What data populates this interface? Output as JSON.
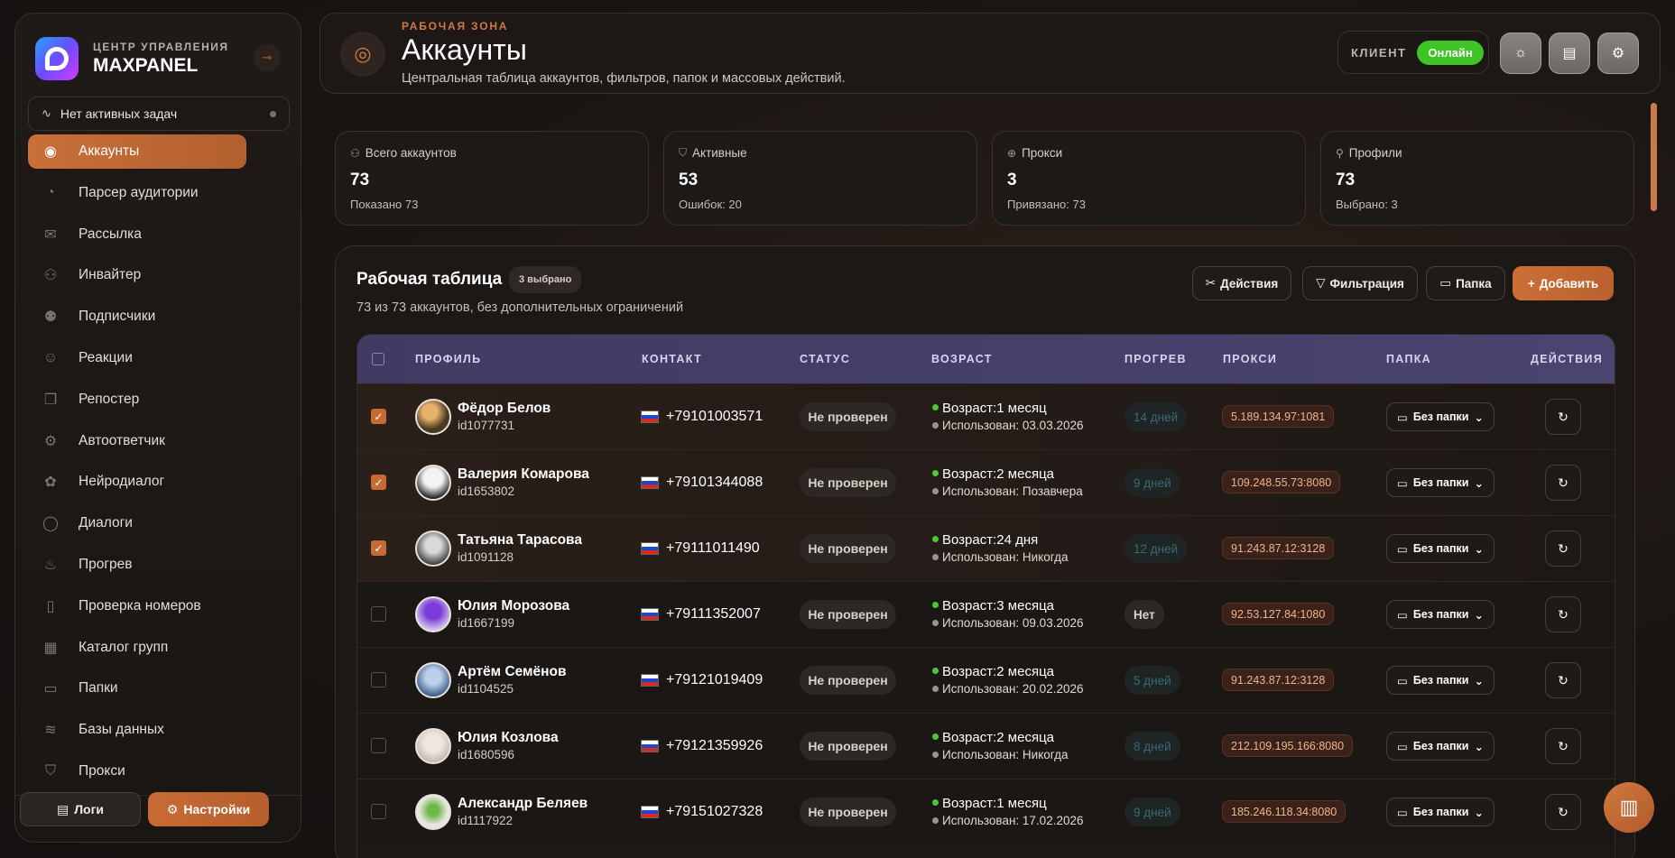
{
  "brand": {
    "subtitle": "ЦЕНТР УПРАВЛЕНИЯ",
    "title": "MAXPANEL",
    "pin_icon": "pin-icon"
  },
  "tasks": {
    "label": "Нет активных задач",
    "icon": "pulse-icon"
  },
  "sidebar": {
    "items": [
      {
        "label": "Аккаунты",
        "icon": "user-circle-icon",
        "glyph": "◉",
        "active": true
      },
      {
        "label": "Парсер аудитории",
        "icon": "radar-icon",
        "glyph": "◔",
        "active": false
      },
      {
        "label": "Рассылка",
        "icon": "mail-icon",
        "glyph": "✉",
        "active": false
      },
      {
        "label": "Инвайтер",
        "icon": "user-plus-icon",
        "glyph": "⚇",
        "active": false
      },
      {
        "label": "Подписчики",
        "icon": "users-icon",
        "glyph": "⚉",
        "active": false
      },
      {
        "label": "Реакции",
        "icon": "smile-icon",
        "glyph": "☺",
        "active": false
      },
      {
        "label": "Репостер",
        "icon": "copy-icon",
        "glyph": "❐",
        "active": false
      },
      {
        "label": "Автоответчик",
        "icon": "bot-icon",
        "glyph": "⚙",
        "active": false
      },
      {
        "label": "Нейродиалог",
        "icon": "brain-icon",
        "glyph": "✿",
        "active": false
      },
      {
        "label": "Диалоги",
        "icon": "chat-icon",
        "glyph": "◯",
        "active": false
      },
      {
        "label": "Прогрев",
        "icon": "flame-icon",
        "glyph": "♨",
        "active": false
      },
      {
        "label": "Проверка номеров",
        "icon": "phone-search-icon",
        "glyph": "▯",
        "active": false
      },
      {
        "label": "Каталог групп",
        "icon": "grid-icon",
        "glyph": "▦",
        "active": false
      },
      {
        "label": "Папки",
        "icon": "folder-icon",
        "glyph": "▭",
        "active": false
      },
      {
        "label": "Базы данных",
        "icon": "database-icon",
        "glyph": "≋",
        "active": false
      },
      {
        "label": "Прокси",
        "icon": "shield-icon",
        "glyph": "⛉",
        "active": false
      }
    ],
    "logs_label": "Логи",
    "settings_label": "Настройки"
  },
  "header": {
    "eyebrow": "РАБОЧАЯ ЗОНА",
    "title": "Аккаунты",
    "subtitle": "Центральная таблица аккаунтов, фильтров, папок и массовых действий.",
    "client_label": "КЛИЕНТ",
    "client_status": "Онлайн",
    "buttons": [
      "sun-icon",
      "document-icon",
      "gear-icon"
    ]
  },
  "stats": [
    {
      "label": "Всего аккаунтов",
      "icon": "users-icon",
      "value": "73",
      "note": "Показано 73"
    },
    {
      "label": "Активные",
      "icon": "shield-check-icon",
      "value": "53",
      "note": "Ошибок: 20"
    },
    {
      "label": "Прокси",
      "icon": "globe-icon",
      "value": "3",
      "note": "Привязано: 73"
    },
    {
      "label": "Профили",
      "icon": "user-icon",
      "value": "73",
      "note": "Выбрано: 3"
    }
  ],
  "panel": {
    "title": "Рабочая таблица",
    "selected": "3 выбрано",
    "subtitle": "73 из 73 аккаунтов, без дополнительных ограничений",
    "actions_label": "Действия",
    "filter_label": "Фильтрация",
    "folder_label": "Папка",
    "add_label": "Добавить"
  },
  "table": {
    "columns": [
      "ПРОФИЛЬ",
      "КОНТАКТ",
      "СТАТУС",
      "ВОЗРАСТ",
      "ПРОГРЕВ",
      "ПРОКСИ",
      "ПАПКА",
      "ДЕЙСТВИЯ"
    ],
    "rows": [
      {
        "checked": true,
        "name": "Фёдор Белов",
        "id": "id1077731",
        "phone": "+79101003571",
        "status": "Не проверен",
        "age": "Возраст:1 месяц",
        "used": "Использован: 03.03.2026",
        "warm": "14 дней",
        "proxy": "5.189.134.97:1081",
        "folder": "Без папки"
      },
      {
        "checked": true,
        "name": "Валерия Комарова",
        "id": "id1653802",
        "phone": "+79101344088",
        "status": "Не проверен",
        "age": "Возраст:2 месяца",
        "used": "Использован: Позавчера",
        "warm": "9 дней",
        "proxy": "109.248.55.73:8080",
        "folder": "Без папки"
      },
      {
        "checked": true,
        "name": "Татьяна Тарасова",
        "id": "id1091128",
        "phone": "+79111011490",
        "status": "Не проверен",
        "age": "Возраст:24 дня",
        "used": "Использован: Никогда",
        "warm": "12 дней",
        "proxy": "91.243.87.12:3128",
        "folder": "Без папки"
      },
      {
        "checked": false,
        "name": "Юлия Морозова",
        "id": "id1667199",
        "phone": "+79111352007",
        "status": "Не проверен",
        "age": "Возраст:3 месяца",
        "used": "Использован: 09.03.2026",
        "warm": "Нет",
        "proxy": "92.53.127.84:1080",
        "folder": "Без папки"
      },
      {
        "checked": false,
        "name": "Артём Семёнов",
        "id": "id1104525",
        "phone": "+79121019409",
        "status": "Не проверен",
        "age": "Возраст:2 месяца",
        "used": "Использован: 20.02.2026",
        "warm": "5 дней",
        "proxy": "91.243.87.12:3128",
        "folder": "Без папки"
      },
      {
        "checked": false,
        "name": "Юлия Козлова",
        "id": "id1680596",
        "phone": "+79121359926",
        "status": "Не проверен",
        "age": "Возраст:2 месяца",
        "used": "Использован: Никогда",
        "warm": "8 дней",
        "proxy": "212.109.195.166:8080",
        "folder": "Без папки"
      },
      {
        "checked": false,
        "name": "Александр Беляев",
        "id": "id1117922",
        "phone": "+79151027328",
        "status": "Не проверен",
        "age": "Возраст:1 месяц",
        "used": "Использован: 17.02.2026",
        "warm": "9 дней",
        "proxy": "185.246.118.34:8080",
        "folder": "Без папки"
      }
    ]
  },
  "colors": {
    "accent": "#c76b36",
    "online": "#3fc425",
    "table_header": "#45406a"
  },
  "fab_icon": "book-icon"
}
